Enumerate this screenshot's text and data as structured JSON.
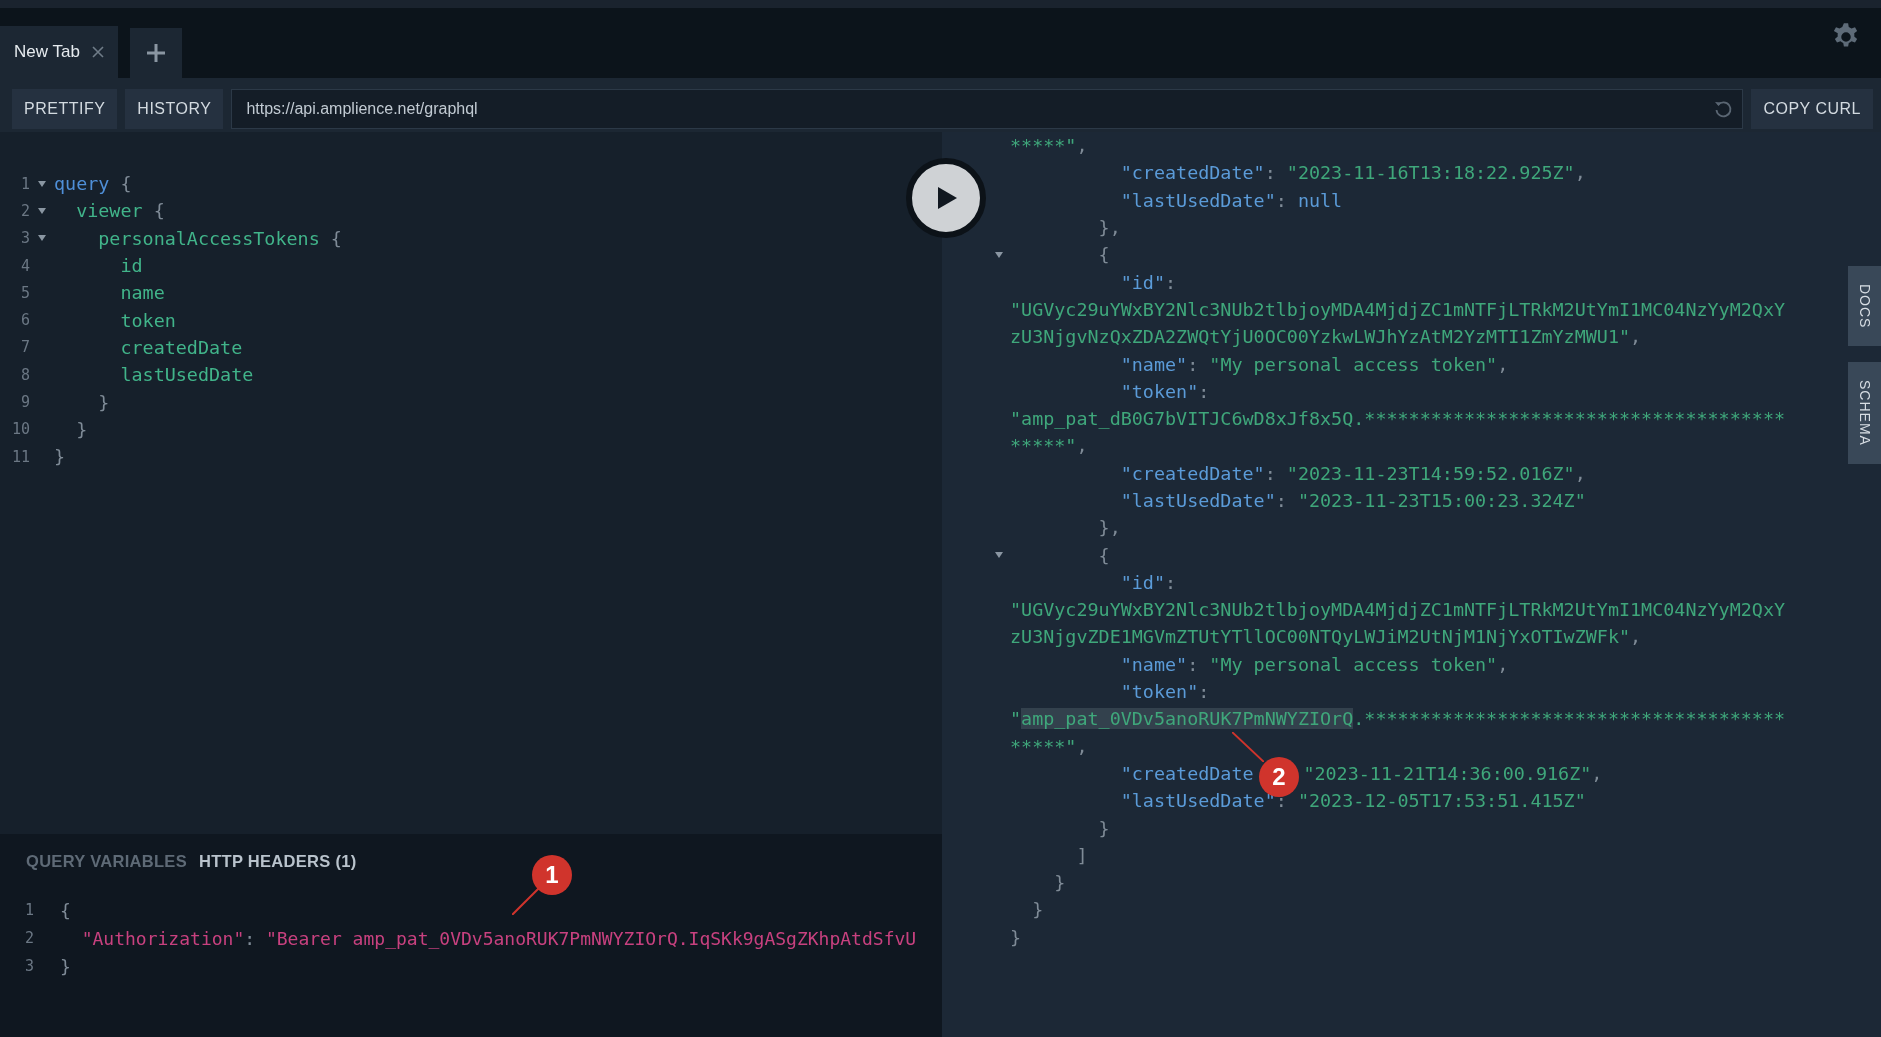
{
  "tabs": [
    {
      "label": "New Tab",
      "selected": true
    }
  ],
  "toolbar": {
    "left_buttons": [
      "PRETTIFY",
      "HISTORY"
    ],
    "url": "https://api.amplience.net/graphql",
    "right_button": "COPY CURL"
  },
  "query_editor": {
    "lines": [
      {
        "num": "1",
        "fold": true,
        "tokens": [
          {
            "kind": "keyword",
            "text": "query"
          },
          {
            "kind": "open",
            "text": " {"
          }
        ]
      },
      {
        "num": "2",
        "fold": true,
        "tokens": [
          {
            "kind": "field",
            "text": "viewer"
          },
          {
            "kind": "open",
            "text": " {"
          }
        ]
      },
      {
        "num": "3",
        "fold": true,
        "tokens": [
          {
            "kind": "field",
            "text": "personalAccessTokens"
          },
          {
            "kind": "open",
            "text": " {"
          }
        ]
      },
      {
        "num": "4",
        "fold": false,
        "tokens": [
          {
            "kind": "field",
            "text": "id"
          }
        ]
      },
      {
        "num": "5",
        "fold": false,
        "tokens": [
          {
            "kind": "field",
            "text": "name"
          }
        ]
      },
      {
        "num": "6",
        "fold": false,
        "tokens": [
          {
            "kind": "field",
            "text": "token"
          }
        ]
      },
      {
        "num": "7",
        "fold": false,
        "tokens": [
          {
            "kind": "field",
            "text": "createdDate"
          }
        ]
      },
      {
        "num": "8",
        "fold": false,
        "tokens": [
          {
            "kind": "field",
            "text": "lastUsedDate"
          }
        ]
      },
      {
        "num": "9",
        "fold": false,
        "tokens": [
          {
            "kind": "close",
            "text": "}"
          }
        ]
      },
      {
        "num": "10",
        "fold": false,
        "tokens": [
          {
            "kind": "close",
            "text": "}"
          }
        ]
      },
      {
        "num": "11",
        "fold": false,
        "tokens": [
          {
            "kind": "close",
            "text": "}"
          }
        ]
      }
    ]
  },
  "variables_panel": {
    "tabs": [
      {
        "label": "QUERY VARIABLES",
        "selected": false
      },
      {
        "label": "HTTP HEADERS (1)",
        "selected": true
      }
    ],
    "lines": [
      {
        "num": "1",
        "tokens": [
          {
            "kind": "open",
            "text": "{"
          }
        ]
      },
      {
        "num": "2",
        "tokens": [
          {
            "kind": "hkey",
            "text": "\"Authorization\""
          },
          {
            "kind": "punct",
            "text": ": "
          },
          {
            "kind": "hstring",
            "text": "\"Bearer amp_pat_0VDv5anoRUK7PmNWYZIOrQ.IqSKk9gASgZKhpAtdSfvU"
          }
        ]
      },
      {
        "num": "3",
        "tokens": [
          {
            "kind": "close",
            "text": "}"
          }
        ]
      }
    ]
  },
  "results": {
    "lines": [
      {
        "fold": false,
        "tokens": [
          {
            "kind": "string",
            "text": "*****\""
          },
          {
            "kind": "punct",
            "text": ","
          }
        ]
      },
      {
        "fold": false,
        "tokens": [
          {
            "kind": "key",
            "text": "\"createdDate\""
          },
          {
            "kind": "punct",
            "text": ": "
          },
          {
            "kind": "string",
            "text": "\"2023-11-16T13:18:22.925Z\""
          },
          {
            "kind": "punct",
            "text": ","
          }
        ]
      },
      {
        "fold": false,
        "tokens": [
          {
            "kind": "key",
            "text": "\"lastUsedDate\""
          },
          {
            "kind": "punct",
            "text": ": "
          },
          {
            "kind": "null",
            "text": "null"
          }
        ]
      },
      {
        "fold": false,
        "tokens": [
          {
            "kind": "close",
            "text": "},"
          }
        ]
      },
      {
        "fold": true,
        "tokens": [
          {
            "kind": "open",
            "text": "{"
          }
        ]
      },
      {
        "fold": false,
        "tokens": [
          {
            "kind": "key",
            "text": "\"id\""
          },
          {
            "kind": "punct",
            "text": ":"
          }
        ]
      },
      {
        "fold": false,
        "tokens": [
          {
            "kind": "string",
            "text": "\"UGVyc29uYWxBY2Nlc3NUb2tlbjoyMDA4MjdjZC1mNTFjLTRkM2UtYmI1MC04NzYyM2QxY"
          }
        ]
      },
      {
        "fold": false,
        "tokens": [
          {
            "kind": "string",
            "text": "zU3NjgvNzQxZDA2ZWQtYjU0OC00YzkwLWJhYzAtM2YzMTI1ZmYzMWU1\""
          },
          {
            "kind": "punct",
            "text": ","
          }
        ]
      },
      {
        "fold": false,
        "tokens": [
          {
            "kind": "key",
            "text": "\"name\""
          },
          {
            "kind": "punct",
            "text": ": "
          },
          {
            "kind": "string",
            "text": "\"My personal access token\""
          },
          {
            "kind": "punct",
            "text": ","
          }
        ]
      },
      {
        "fold": false,
        "tokens": [
          {
            "kind": "key",
            "text": "\"token\""
          },
          {
            "kind": "punct",
            "text": ":"
          }
        ]
      },
      {
        "fold": false,
        "tokens": [
          {
            "kind": "string",
            "text": "\"amp_pat_dB0G7bVITJC6wD8xJf8x5Q.**************************************"
          }
        ]
      },
      {
        "fold": false,
        "tokens": [
          {
            "kind": "string",
            "text": "*****\""
          },
          {
            "kind": "punct",
            "text": ","
          }
        ]
      },
      {
        "fold": false,
        "tokens": [
          {
            "kind": "key",
            "text": "\"createdDate\""
          },
          {
            "kind": "punct",
            "text": ": "
          },
          {
            "kind": "string",
            "text": "\"2023-11-23T14:59:52.016Z\""
          },
          {
            "kind": "punct",
            "text": ","
          }
        ]
      },
      {
        "fold": false,
        "tokens": [
          {
            "kind": "key",
            "text": "\"lastUsedDate\""
          },
          {
            "kind": "punct",
            "text": ": "
          },
          {
            "kind": "string",
            "text": "\"2023-11-23T15:00:23.324Z\""
          }
        ]
      },
      {
        "fold": false,
        "tokens": [
          {
            "kind": "close",
            "text": "},"
          }
        ]
      },
      {
        "fold": true,
        "tokens": [
          {
            "kind": "open",
            "text": "{"
          }
        ]
      },
      {
        "fold": false,
        "tokens": [
          {
            "kind": "key",
            "text": "\"id\""
          },
          {
            "kind": "punct",
            "text": ":"
          }
        ]
      },
      {
        "fold": false,
        "tokens": [
          {
            "kind": "string",
            "text": "\"UGVyc29uYWxBY2Nlc3NUb2tlbjoyMDA4MjdjZC1mNTFjLTRkM2UtYmI1MC04NzYyM2QxY"
          }
        ]
      },
      {
        "fold": false,
        "tokens": [
          {
            "kind": "string",
            "text": "zU3NjgvZDE1MGVmZTUtYTllOC00NTQyLWJiM2UtNjM1NjYxOTIwZWFk\""
          },
          {
            "kind": "punct",
            "text": ","
          }
        ]
      },
      {
        "fold": false,
        "tokens": [
          {
            "kind": "key",
            "text": "\"name\""
          },
          {
            "kind": "punct",
            "text": ": "
          },
          {
            "kind": "string",
            "text": "\"My personal access token\""
          },
          {
            "kind": "punct",
            "text": ","
          }
        ]
      },
      {
        "fold": false,
        "tokens": [
          {
            "kind": "key",
            "text": "\"token\""
          },
          {
            "kind": "punct",
            "text": ":"
          }
        ]
      },
      {
        "fold": false,
        "tokens": [
          {
            "kind": "string",
            "text": "\""
          },
          {
            "kind": "selection",
            "text": "amp_pat_0VDv5anoRUK7PmNWYZIOrQ"
          },
          {
            "kind": "string",
            "text": ".**************************************"
          }
        ]
      },
      {
        "fold": false,
        "tokens": [
          {
            "kind": "string",
            "text": "*****\""
          },
          {
            "kind": "punct",
            "text": ","
          }
        ]
      },
      {
        "fold": false,
        "tokens": [
          {
            "kind": "key",
            "text": "\"createdDate"
          },
          {
            "kind": "gap"
          },
          {
            "kind": "string",
            "text": "\"2023-11-21T14:36:00.916Z\""
          },
          {
            "kind": "punct",
            "text": ","
          }
        ]
      },
      {
        "fold": false,
        "tokens": [
          {
            "kind": "key",
            "text": "\"lastUsedDate\""
          },
          {
            "kind": "punct",
            "text": ": "
          },
          {
            "kind": "string",
            "text": "\"2023-12-05T17:53:51.415Z\""
          }
        ]
      },
      {
        "fold": false,
        "tokens": [
          {
            "kind": "close",
            "text": "}"
          }
        ]
      },
      {
        "fold": false,
        "tokens": [
          {
            "kind": "close",
            "text": "]"
          }
        ]
      },
      {
        "fold": false,
        "tokens": [
          {
            "kind": "close",
            "text": "}"
          }
        ]
      },
      {
        "fold": false,
        "tokens": [
          {
            "kind": "close",
            "text": "}"
          }
        ]
      },
      {
        "fold": false,
        "tokens": [
          {
            "kind": "close",
            "text": "}"
          }
        ]
      }
    ]
  },
  "side_tabs": [
    "DOCS",
    "SCHEMA"
  ],
  "annotations": [
    {
      "label": "1"
    },
    {
      "label": "2"
    }
  ]
}
